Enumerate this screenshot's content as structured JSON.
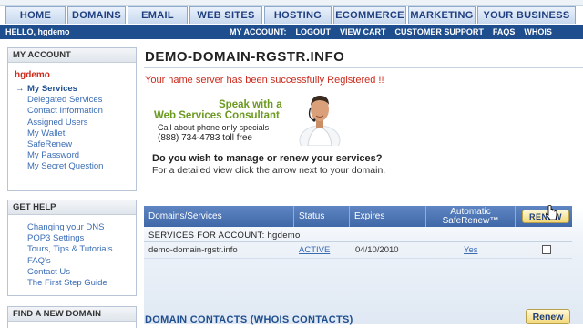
{
  "nav": {
    "tabs": [
      "HOME",
      "DOMAINS",
      "EMAIL",
      "WEB SITES",
      "HOSTING",
      "ECOMMERCE",
      "MARKETING",
      "YOUR BUSINESS"
    ]
  },
  "userbar": {
    "hello": "HELLO, hgdemo",
    "links": [
      "MY ACCOUNT:",
      "LOGOUT",
      "VIEW CART",
      "CUSTOMER SUPPORT",
      "FAQS",
      "WHOIS"
    ]
  },
  "sidebar": {
    "my_account": {
      "title": "MY ACCOUNT",
      "user": "hgdemo",
      "items": [
        "My Services",
        "Delegated Services",
        "Contact Information",
        "Assigned Users",
        "My Wallet",
        "SafeRenew",
        "My Password",
        "My Secret Question"
      ]
    },
    "get_help": {
      "title": "GET HELP",
      "items": [
        "Changing your DNS",
        "POP3 Settings",
        "Tours, Tips & Tutorials",
        "FAQ's",
        "Contact Us",
        "The First Step Guide"
      ]
    },
    "find_domain": {
      "title": "FIND A NEW DOMAIN"
    }
  },
  "main": {
    "title": "DEMO-DOMAIN-RGSTR.INFO",
    "success": "Your name server has been successfully Registered !!",
    "promo": {
      "speak": "Speak with a",
      "consultant": "Web Services Consultant",
      "call": "Call about phone only specials",
      "phone": "(888) 734-4783 toll free"
    },
    "question": "Do you wish to manage or renew your services?",
    "detail": "For a detailed view click the arrow next to your domain.",
    "table": {
      "headers": {
        "domains": "Domains/Services",
        "status": "Status",
        "expires": "Expires",
        "saferenew_line1": "Automatic",
        "saferenew_line2": "SafeRenew™",
        "renew_button": "RENEW"
      },
      "account_label": "SERVICES FOR ACCOUNT: hgdemo",
      "rows": [
        {
          "domain": "demo-domain-rgstr.info",
          "status": "ACTIVE",
          "expires": "04/10/2010",
          "saferenew": "Yes"
        }
      ],
      "renew_label": "Renew"
    },
    "contacts_heading": "DOMAIN CONTACTS (WHOIS CONTACTS)"
  },
  "colors": {
    "nav_text": "#1f3f80",
    "bar_bg": "#1f4e8f",
    "alert_red": "#cc2b1d",
    "promo_green": "#6b9a1f",
    "link_blue": "#3a6cb4"
  }
}
